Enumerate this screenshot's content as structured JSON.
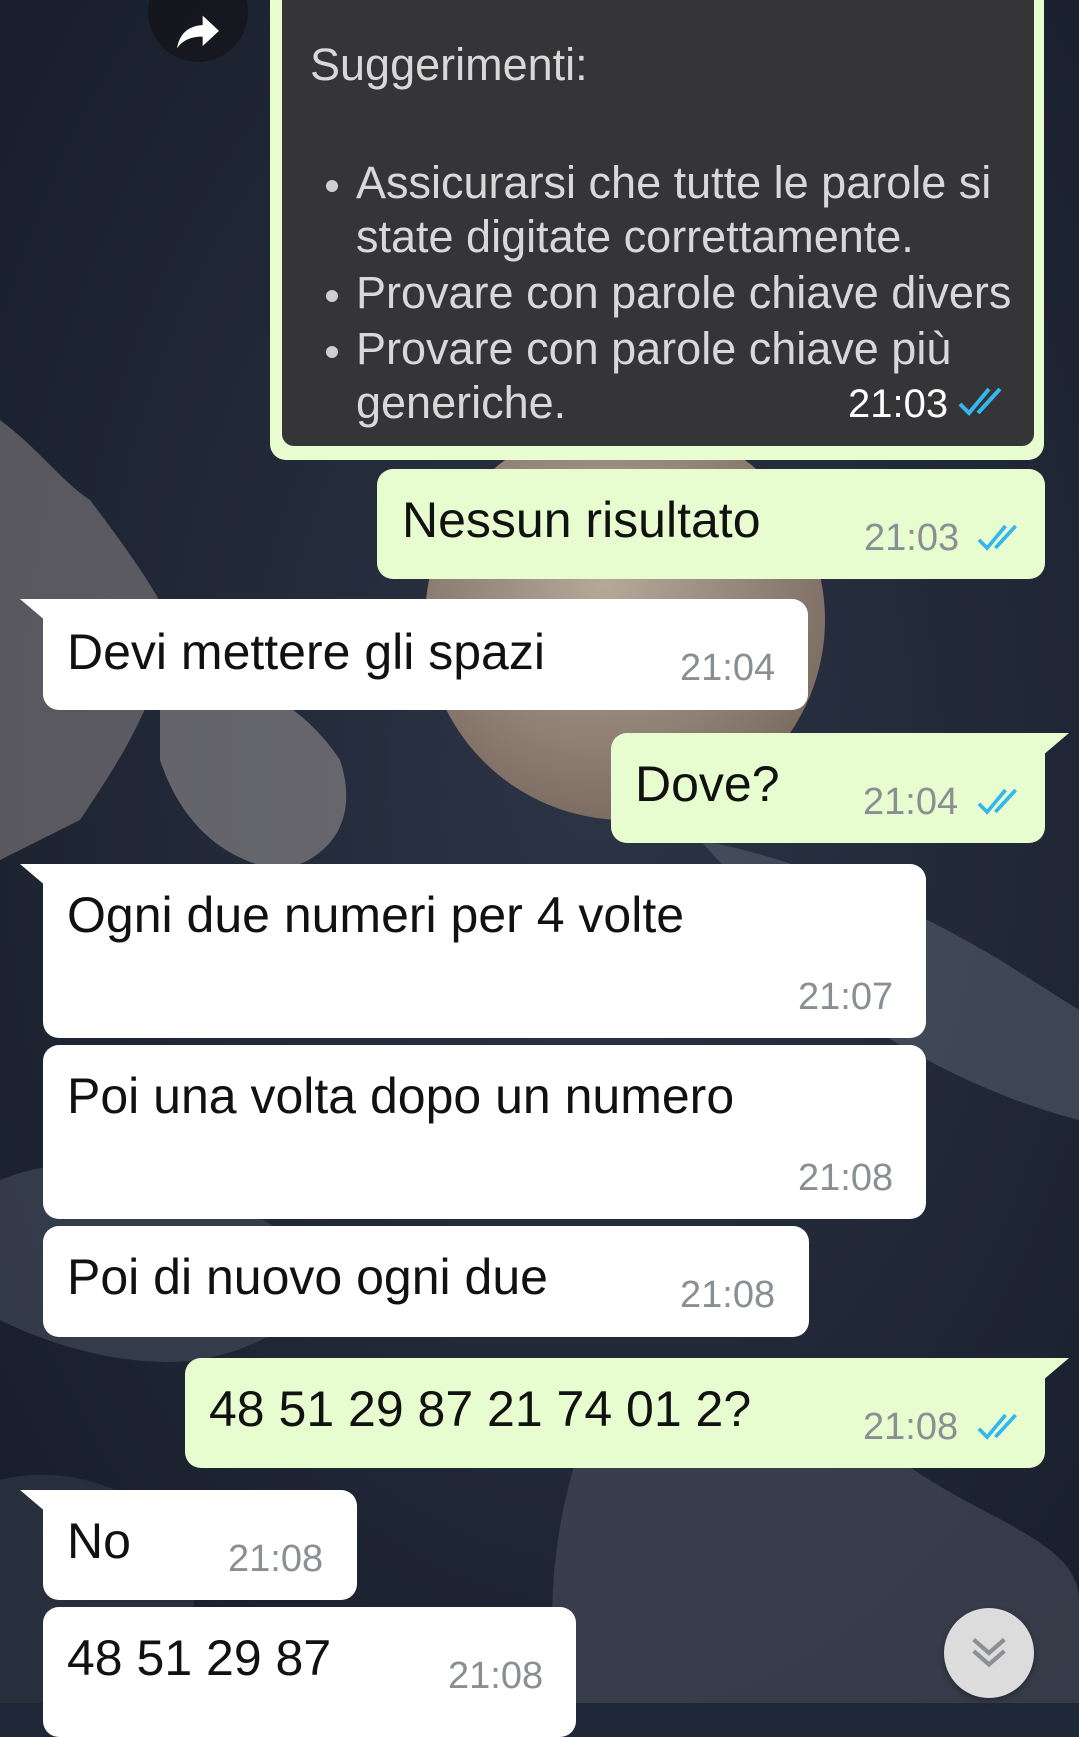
{
  "colors": {
    "incoming_bubble": "#ffffff",
    "outgoing_bubble": "#e7fccf",
    "read_ticks": "#34b7f1",
    "timestamp": "#8a8f93",
    "quoted_panel": "#353538"
  },
  "forward_button": {
    "icon": "forward-arrow-icon"
  },
  "quoted_document": {
    "heading": "Suggerimenti:",
    "bullets": [
      {
        "line1": "Assicurarsi che tutte le parole si",
        "line2": "state digitate correttamente."
      },
      {
        "line1": "Provare con parole chiave divers",
        "line2": ""
      },
      {
        "line1": "Provare con parole chiave più",
        "line2": "generiche."
      }
    ],
    "time": "21:03",
    "read_icon": "double-check-icon"
  },
  "messages": [
    {
      "direction": "out",
      "text": "Nessun risultato",
      "time": "21:03",
      "read": true
    },
    {
      "direction": "in",
      "text": "Devi mettere gli spazi",
      "time": "21:04"
    },
    {
      "direction": "out",
      "text": "Dove?",
      "time": "21:04",
      "read": true
    },
    {
      "direction": "in",
      "text": "Ogni due numeri per 4 volte",
      "time": "21:07"
    },
    {
      "direction": "in",
      "text": "Poi una volta dopo un numero",
      "time": "21:08"
    },
    {
      "direction": "in",
      "text": "Poi di nuovo ogni due",
      "time": "21:08"
    },
    {
      "direction": "out",
      "text": "48 51 29 87 21 74 01 2?",
      "time": "21:08",
      "read": true
    },
    {
      "direction": "in",
      "text": "No",
      "time": "21:08"
    },
    {
      "direction": "in",
      "text": "48 51 29 87",
      "time": "21:08"
    }
  ],
  "scroll_to_bottom": {
    "icon": "chevron-double-down-icon"
  }
}
